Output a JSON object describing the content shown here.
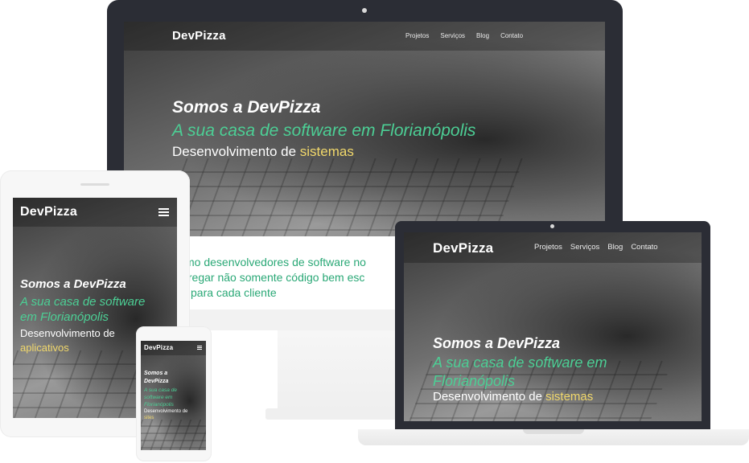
{
  "brand": {
    "logo": "DevPizza"
  },
  "nav": [
    "Projetos",
    "Serviços",
    "Blog",
    "Contato"
  ],
  "hero": {
    "title": "Somos a DevPizza",
    "subtitle_full": "A sua casa de software em Florianópolis",
    "subtitle_line1": "A sua casa de software",
    "subtitle_line2": "em Florianópolis",
    "subtitle_line1_b": "A sua casa de software em",
    "subtitle_line2_b": "Florianópolis",
    "tagline_prefix": "Desenvolvimento de",
    "tagline_sistemas": "sistemas",
    "tagline_aplicativos": "aplicativos"
  },
  "about": {
    "line1": "mo desenvolvedores de software no",
    "line2": "tregar não somente código bem esc",
    "line3": "l para cada cliente"
  },
  "phone": {
    "title_line1": "Somos a",
    "title_line2": "DevPizza",
    "sub_line1": "A sua casa de",
    "sub_line2": "software em",
    "sub_line3": "Florianópolis",
    "tag_line1": "Desenvolvimento de",
    "tag_line2": "sites"
  },
  "colors": {
    "accent_green": "#4ccf95",
    "accent_yellow": "#f1d86b",
    "device_dark": "#2b2d35"
  },
  "icons": {
    "menu": "hamburger-menu-icon"
  }
}
